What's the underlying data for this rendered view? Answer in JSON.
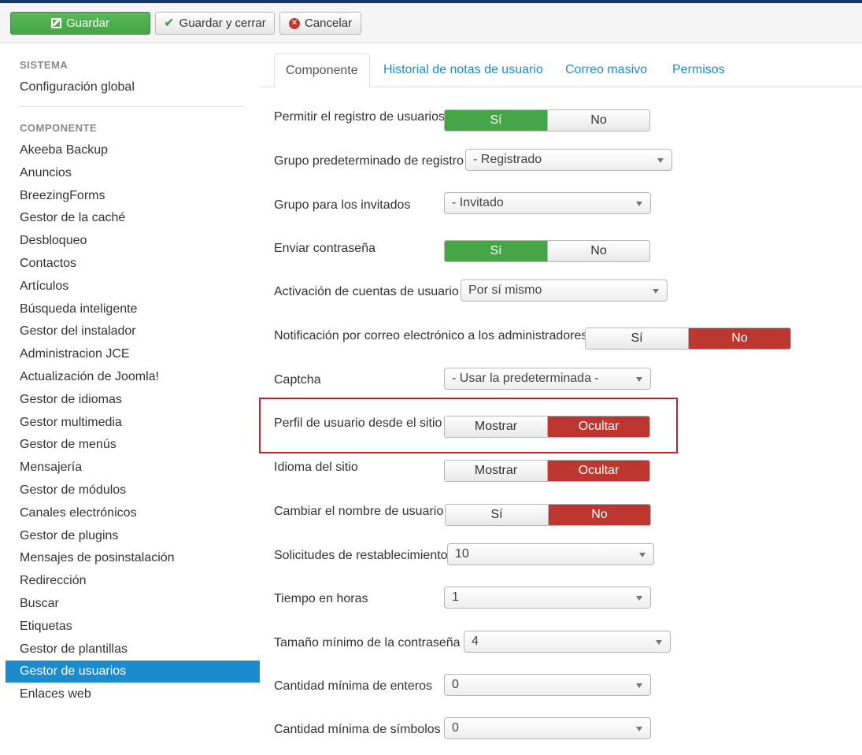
{
  "toolbar": {
    "save_label": "Guardar",
    "save_close_label": "Guardar y cerrar",
    "cancel_label": "Cancelar"
  },
  "sidebar": {
    "system_heading": "SISTEMA",
    "global_config": "Configuración global",
    "component_heading": "COMPONENTE",
    "items": [
      "Akeeba Backup",
      "Anuncios",
      "BreezingForms",
      "Gestor de la caché",
      "Desbloqueo",
      "Contactos",
      "Artículos",
      "Búsqueda inteligente",
      "Gestor del instalador",
      "Administracion JCE",
      "Actualización de Joomla!",
      "Gestor de idiomas",
      "Gestor multimedia",
      "Gestor de menús",
      "Mensajería",
      "Gestor de módulos",
      "Canales electrónicos",
      "Gestor de plugins",
      "Mensajes de posinstalación",
      "Redirección",
      "Buscar",
      "Etiquetas",
      "Gestor de plantillas",
      "Gestor de usuarios",
      "Enlaces web"
    ],
    "active_item": "Gestor de usuarios"
  },
  "tabs": [
    "Componente",
    "Historial de notas de usuario",
    "Correo masivo",
    "Permisos"
  ],
  "active_tab": "Componente",
  "colors": {
    "accent": "#1a8cce",
    "green": "#46a546",
    "red": "#bd362f",
    "highlight_border": "#c8202a"
  },
  "fields": [
    {
      "label": "Permitir el registro de usuarios",
      "type": "toggle",
      "options": [
        "Sí",
        "No"
      ],
      "selected": "Sí"
    },
    {
      "label": "Grupo predeterminado de registro",
      "type": "select",
      "value": "- Registrado"
    },
    {
      "label": "Grupo para los invitados",
      "type": "select",
      "value": "- Invitado"
    },
    {
      "label": "Enviar contraseña",
      "type": "toggle",
      "options": [
        "Sí",
        "No"
      ],
      "selected": "Sí"
    },
    {
      "label": "Activación de cuentas de usuario",
      "type": "select",
      "value": "Por sí mismo"
    },
    {
      "label": "Notificación por correo electrónico a los administradores",
      "type": "toggle",
      "options": [
        "Sí",
        "No"
      ],
      "selected": "No"
    },
    {
      "label": "Captcha",
      "type": "select",
      "value": "- Usar la predeterminada -"
    },
    {
      "label": "Perfil de usuario desde el sitio",
      "type": "toggle",
      "options": [
        "Mostrar",
        "Ocultar"
      ],
      "selected": "Ocultar"
    },
    {
      "label": "Idioma del sitio",
      "type": "toggle",
      "options": [
        "Mostrar",
        "Ocultar"
      ],
      "selected": "Ocultar"
    },
    {
      "label": "Cambiar el nombre de usuario",
      "type": "toggle",
      "options": [
        "Sí",
        "No"
      ],
      "selected": "No"
    },
    {
      "label": "Solicitudes de restablecimiento",
      "type": "select",
      "value": "10"
    },
    {
      "label": "Tiempo en horas",
      "type": "select",
      "value": "1"
    },
    {
      "label": "Tamaño mínimo de la contraseña",
      "type": "select",
      "value": "4"
    },
    {
      "label": "Cantidad mínima de enteros",
      "type": "select",
      "value": "0"
    },
    {
      "label": "Cantidad mínima de símbolos",
      "type": "select",
      "value": "0"
    }
  ]
}
